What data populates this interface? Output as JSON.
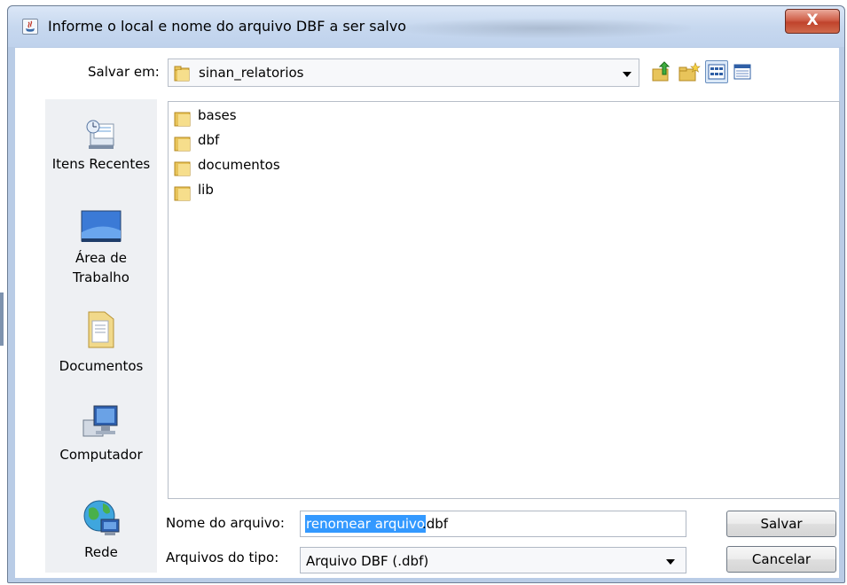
{
  "window": {
    "title": "Informe o local e nome do arquivo DBF a ser salvo",
    "close_label": "X"
  },
  "toolbar": {
    "save_in_label": "Salvar em:",
    "current_folder": "sinan_relatorios",
    "icons": [
      "up-folder-icon",
      "new-folder-icon",
      "list-view-icon",
      "details-view-icon"
    ]
  },
  "places": [
    {
      "label": "Itens Recentes",
      "icon": "recent-items-icon"
    },
    {
      "label": "Área de Trabalho",
      "icon": "desktop-icon"
    },
    {
      "label": "Documentos",
      "icon": "documents-icon"
    },
    {
      "label": "Computador",
      "icon": "computer-icon"
    },
    {
      "label": "Rede",
      "icon": "network-icon"
    }
  ],
  "files": [
    {
      "name": "bases",
      "icon": "folder-icon"
    },
    {
      "name": "dbf",
      "icon": "folder-icon"
    },
    {
      "name": "documentos",
      "icon": "folder-icon"
    },
    {
      "name": "lib",
      "icon": "folder-icon"
    }
  ],
  "filename": {
    "label": "Nome do arquivo:",
    "selected_text": "renomear arquivo",
    "rest_text": ".dbf"
  },
  "filetype": {
    "label": "Arquivos do tipo:",
    "value": "Arquivo DBF (.dbf)"
  },
  "buttons": {
    "save": "Salvar",
    "cancel": "Cancelar"
  },
  "colors": {
    "selection": "#3399ff",
    "title_bar": "#c7d8ef",
    "close_button": "#c0432c"
  }
}
